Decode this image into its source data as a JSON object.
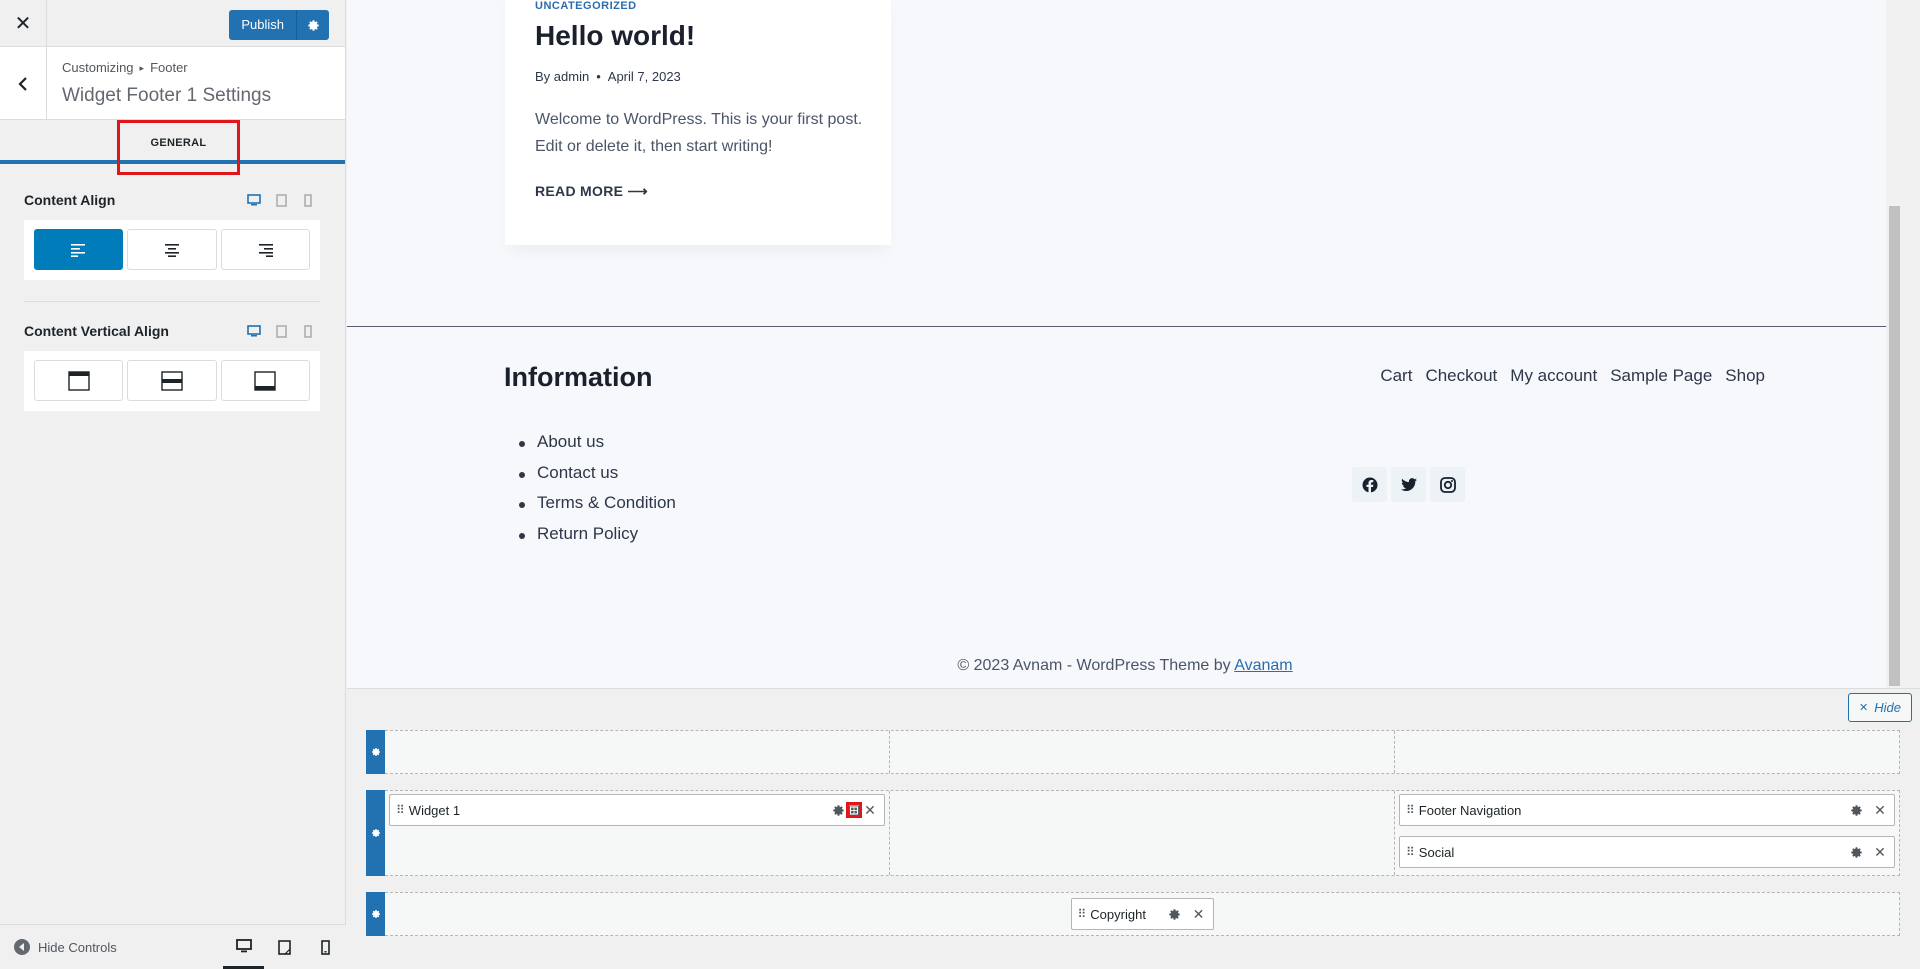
{
  "sidebar": {
    "close_icon": "close-icon",
    "publish_label": "Publish",
    "breadcrumb": {
      "root": "Customizing",
      "section": "Footer"
    },
    "title": "Widget Footer 1 Settings",
    "tab_general": "GENERAL",
    "content_align": {
      "label": "Content Align",
      "options": [
        "align-left",
        "align-center",
        "align-right"
      ],
      "selected": "align-left"
    },
    "content_vertical_align": {
      "label": "Content Vertical Align",
      "options": [
        "align-top",
        "align-middle",
        "align-bottom"
      ]
    },
    "hide_controls": "Hide Controls",
    "accent": "#2271b1"
  },
  "preview": {
    "post": {
      "category": "UNCATEGORIZED",
      "title": "Hello world!",
      "by": "By",
      "author": "admin",
      "date": "April 7, 2023",
      "excerpt": "Welcome to WordPress. This is your first post. Edit or delete it, then start writing!",
      "read_more": "READ MORE"
    },
    "footer": {
      "info_title": "Information",
      "info_links": [
        "About us",
        "Contact us",
        "Terms & Condition",
        "Return Policy"
      ],
      "nav": [
        "Cart",
        "Checkout",
        "My account",
        "Sample Page",
        "Shop"
      ],
      "social": [
        "facebook-icon",
        "twitter-icon",
        "instagram-icon"
      ],
      "copyright_text": "© 2023 Avnam - WordPress Theme by ",
      "copyright_link": "Avanam"
    }
  },
  "builder": {
    "hide_label": "Hide",
    "rows": {
      "middle": {
        "left": [
          "Widget 1"
        ],
        "right": [
          "Footer Navigation",
          "Social"
        ]
      },
      "bottom": {
        "center": [
          "Copyright"
        ]
      }
    }
  }
}
